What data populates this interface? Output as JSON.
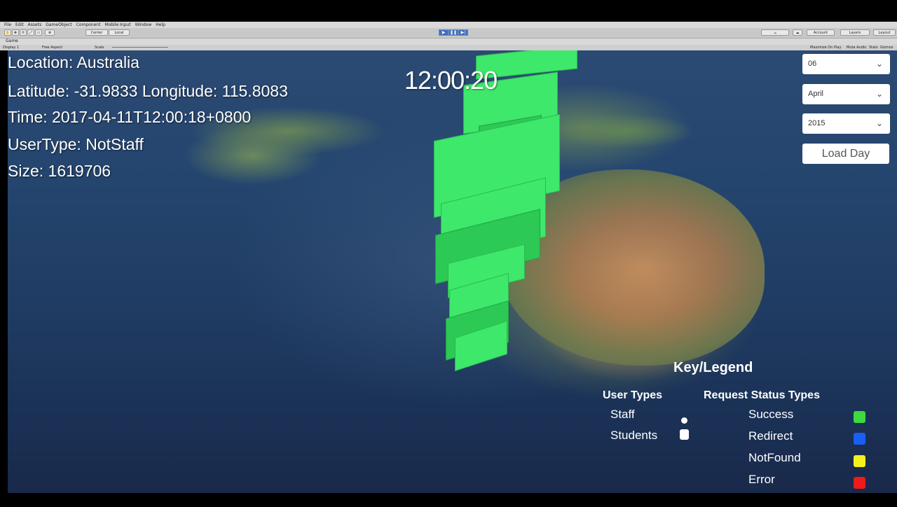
{
  "editor": {
    "menu": [
      "File",
      "Edit",
      "Assets",
      "GameObject",
      "Component",
      "Mobile Input",
      "Window",
      "Help"
    ],
    "tool_buttons": [
      "Center",
      "Local"
    ],
    "right_buttons": [
      "Account",
      "Layers",
      "Layout"
    ],
    "game_tab": "Game",
    "display": "Display 1",
    "aspect": "Free Aspect",
    "scale_label": "Scale",
    "game_options": [
      "Maximize On Play",
      "Mute Audio",
      "Stats",
      "Gizmos"
    ]
  },
  "hud": {
    "location": "Location: Australia",
    "latlon": "Latitude: -31.9833 Longitude: 115.8083",
    "time": "Time: 2017-04-11T12:00:18+0800",
    "usertype": "UserType: NotStaff",
    "size": "Size: 1619706",
    "clock": "12:00:20"
  },
  "controls": {
    "day": "06",
    "month": "April",
    "year": "2015",
    "load_button": "Load Day"
  },
  "legend": {
    "title": "Key/Legend",
    "user_types_heading": "User Types",
    "request_heading": "Request Status Types",
    "user_types": [
      "Staff",
      "Students"
    ],
    "statuses": [
      {
        "label": "Success",
        "color": "#3fd83f"
      },
      {
        "label": "Redirect",
        "color": "#1a5ff5"
      },
      {
        "label": "NotFound",
        "color": "#f5f01a"
      },
      {
        "label": "Error",
        "color": "#f01a1a"
      }
    ]
  },
  "colors": {
    "bar": "#3de86a"
  }
}
